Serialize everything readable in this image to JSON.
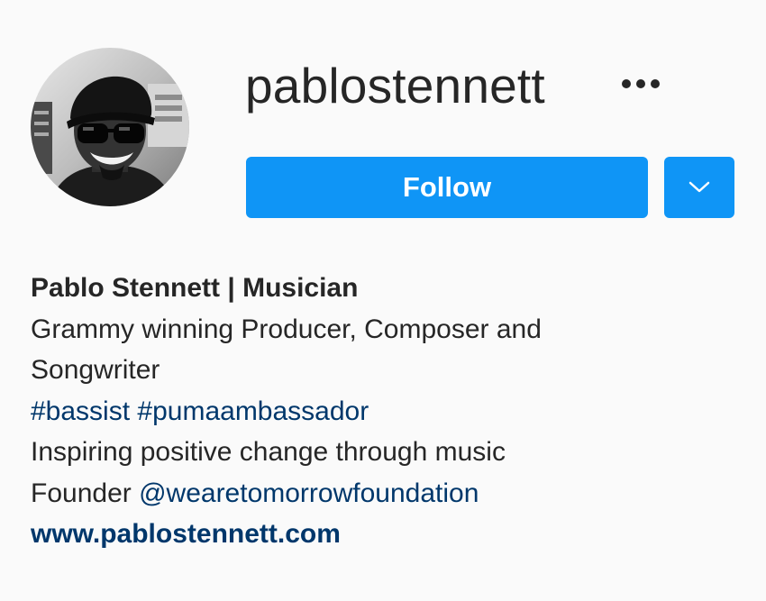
{
  "profile": {
    "username": "pablostennett",
    "avatar_icon": "profile-photo",
    "more_icon": "more-horizontal-icon",
    "follow_label": "Follow",
    "dropdown_icon": "chevron-down-icon",
    "accent_color": "#0f95f6",
    "link_color": "#00376b"
  },
  "bio": {
    "display_name": "Pablo Stennett | Musician",
    "line1": "Grammy winning Producer, Composer and",
    "line2": "Songwriter",
    "hashtag1": "#bassist",
    "hashtag2": "#pumaambassador",
    "line4": "Inspiring positive change through music",
    "founder_prefix": "Founder ",
    "founder_mention": "@wearetomorrowfoundation",
    "website": "www.pablostennett.com"
  }
}
